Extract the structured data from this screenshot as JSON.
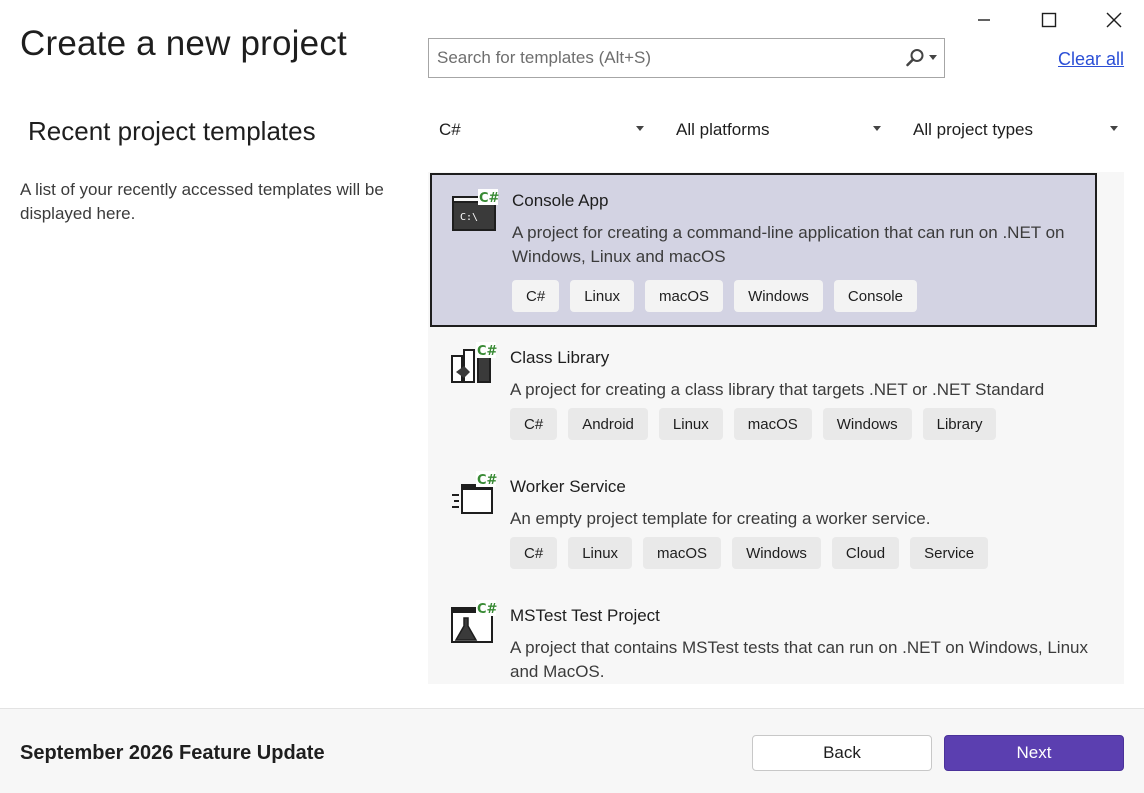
{
  "window_controls": {
    "minimize": "minimize",
    "maximize": "maximize",
    "close": "close"
  },
  "page": {
    "title": "Create a new project"
  },
  "search": {
    "placeholder": "Search for templates (Alt+S)",
    "icon": "search-icon"
  },
  "clear_all_label": "Clear all",
  "recent": {
    "title": "Recent project templates",
    "description": "A list of your recently accessed templates will be displayed here."
  },
  "filters": {
    "language": "C#",
    "platform": "All platforms",
    "project_type": "All project types"
  },
  "templates": [
    {
      "title": "Console App",
      "description": "A project for creating a command-line application that can run on .NET on Windows, Linux and macOS",
      "tags": [
        "C#",
        "Linux",
        "macOS",
        "Windows",
        "Console"
      ],
      "icon": "console-app-icon",
      "selected": true
    },
    {
      "title": "Class Library",
      "description": "A project for creating a class library that targets .NET or .NET Standard",
      "tags": [
        "C#",
        "Android",
        "Linux",
        "macOS",
        "Windows",
        "Library"
      ],
      "icon": "class-library-icon",
      "selected": false
    },
    {
      "title": "Worker Service",
      "description": "An empty project template for creating a worker service.",
      "tags": [
        "C#",
        "Linux",
        "macOS",
        "Windows",
        "Cloud",
        "Service"
      ],
      "icon": "worker-service-icon",
      "selected": false
    },
    {
      "title": "MSTest Test Project",
      "description": "A project that contains MSTest tests that can run on .NET on Windows, Linux and MacOS.",
      "tags": [],
      "icon": "mstest-icon",
      "selected": false
    }
  ],
  "footer": {
    "label": "September 2026 Feature Update",
    "back_label": "Back",
    "next_label": "Next"
  },
  "colors": {
    "accent": "#5b3fb0",
    "link": "#2b4fd6",
    "selected_bg": "#d3d3e3",
    "csharp_badge": "#388a34"
  }
}
